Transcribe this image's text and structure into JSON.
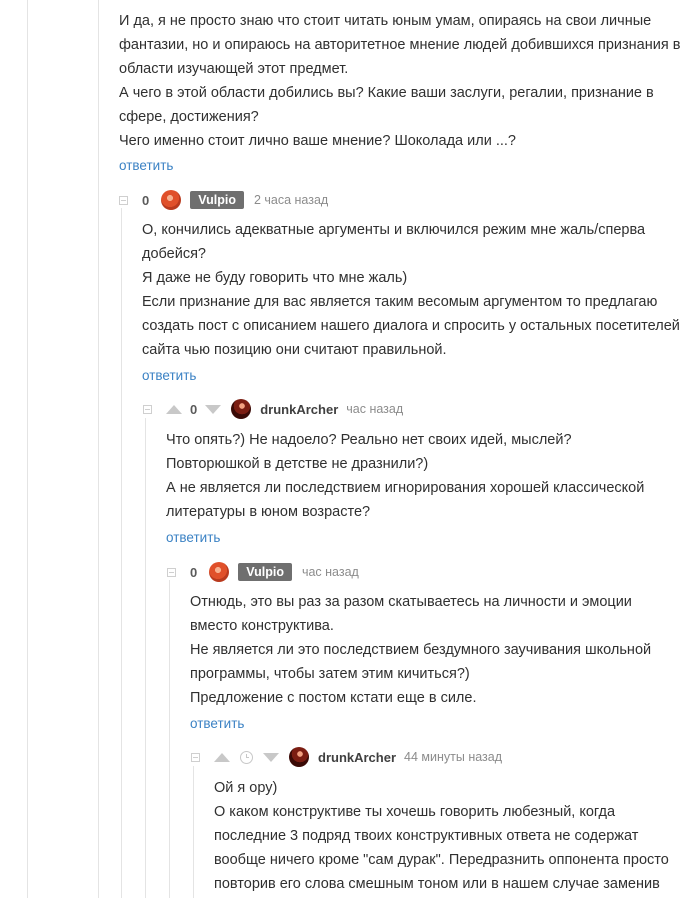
{
  "top_comment": {
    "lines": [
      "И да, я не просто знаю что стоит читать юным умам, опираясь на свои личные",
      "фантазии, но и опираюсь на авторитетное мнение людей добившихся признания в",
      "области изучающей этот предмет.",
      "А чего в этой области добились вы? Какие ваши заслуги, регалии, признание в",
      "сфере, достижения?",
      "Чего именно стоит лично ваше мнение? Шоколада или ...?"
    ],
    "reply": "ответить"
  },
  "comments": [
    {
      "rating": "0",
      "user": "Vulpio",
      "time": "2 часа назад",
      "lines": [
        "О, кончились адекватные аргументы и включился режим мне жаль/сперва",
        "добейся?",
        "Я даже не буду говорить что мне жаль)",
        "Если признание для вас является таким весомым аргументом то предлагаю",
        "создать пост с описанием нашего диалога и спросить у остальных посетителей",
        "сайта чью позицию они считают правильной."
      ],
      "reply": "ответить"
    },
    {
      "rating": "0",
      "user": "drunkArcher",
      "time": "час назад",
      "lines": [
        "Что опять?) Не надоело? Реально нет своих идей, мыслей?",
        "Повторюшкой в детстве не дразнили?)",
        "А не является ли последствием игнорирования хорошей классической",
        "литературы в юном возрасте?"
      ],
      "reply": "ответить"
    },
    {
      "rating": "0",
      "user": "Vulpio",
      "time": "час назад",
      "lines": [
        "Отнюдь, это вы раз за разом скатываетесь на личности и эмоции",
        "вместо конструктива.",
        "Не является ли это последствием бездумного заучивания школьной",
        "программы, чтобы затем этим кичиться?)",
        "Предложение с постом кстати еще в силе."
      ],
      "reply": "ответить"
    },
    {
      "user": "drunkArcher",
      "time": "44 минуты назад",
      "lines": [
        "Ой я ору)",
        "О каком конструктиве ты хочешь говорить любезный, когда",
        "последние 3 подряд твоих конструктивных ответа не содержат",
        "вообще ничего кроме \"сам дурак\". Передразнить оппонента просто",
        "повторив его слова смешным тоном или в нашем случае заменив"
      ]
    }
  ]
}
